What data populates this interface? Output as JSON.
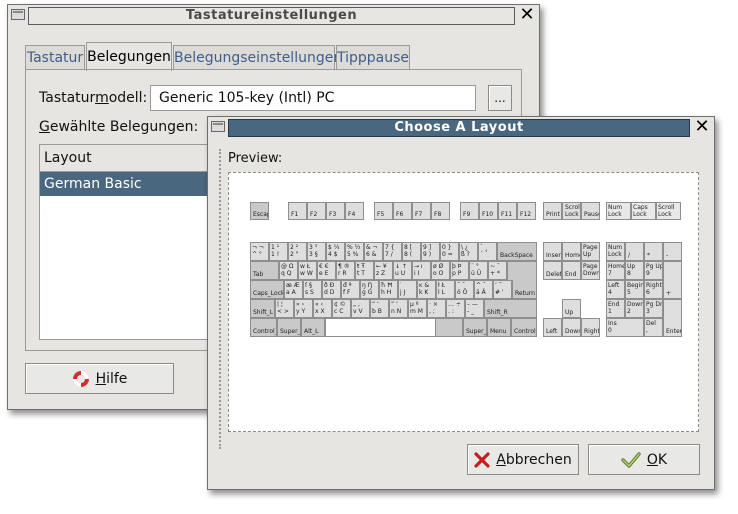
{
  "back_window": {
    "title": "Tastatureinstellungen",
    "tabs": [
      {
        "label": "Tastatur",
        "active": false
      },
      {
        "label": "Belegungen",
        "active": true
      },
      {
        "label": "Belegungseinstellungen",
        "active": false
      },
      {
        "label": "Tipppause",
        "active": false
      }
    ],
    "model_label_pre": "Tastatur",
    "model_label_u": "m",
    "model_label_post": "odell:",
    "model_value": "Generic 105-key (Intl) PC",
    "browse_label": "...",
    "selected_label_pre": "",
    "selected_label_u": "G",
    "selected_label_post": "ewählte Belegungen:",
    "layout_column": "Layout",
    "layouts": [
      "German Basic"
    ],
    "help_u": "H",
    "help_rest": "ilfe"
  },
  "dialog": {
    "title": "Choose A Layout",
    "preview_label": "Preview:",
    "cancel_u": "A",
    "cancel_rest": "bbrechen",
    "ok_u": "O",
    "ok_rest": "K"
  },
  "icons": {
    "help": "lifebuoy-icon",
    "cancel": "red-x-icon",
    "ok": "green-check-icon",
    "close": "close-icon"
  },
  "keys": {
    "esc": "Escape",
    "f1": "F1",
    "f2": "F2",
    "f3": "F3",
    "f4": "F4",
    "f5": "F5",
    "f6": "F6",
    "f7": "F7",
    "f8": "F8",
    "f9": "F9",
    "f10": "F10",
    "f11": "F11",
    "f12": "F12",
    "print": "Print",
    "scroll": "Scroll\nLock",
    "pause": "Pause",
    "numlock": "Num\nLock",
    "capslock_ind": "Caps\nLock",
    "scrolllock_ind": "Scroll\nLock",
    "backspace": "BackSpace",
    "tab": "Tab",
    "return": "Return",
    "capslock": "Caps_Lock",
    "shift_l": "Shift_L",
    "shift_r": "Shift_R",
    "control_l": "Control_L",
    "super_l": "Super_L",
    "alt_l": "Alt_L",
    "super_r": "Super_R",
    "menu": "Menu",
    "control_r": "Control_R",
    "insert": "Insert",
    "home": "Home",
    "pageup": "Page\nUp",
    "delete": "Delete",
    "end": "End",
    "pagedown": "Page\nDown",
    "up": "Up",
    "left": "Left",
    "down": "Down",
    "right": "Right",
    "num_lock_key": "Num\nLock",
    "kp_div": "/",
    "kp_mul": "*",
    "kp_sub": "-",
    "kp_home": "Home\n7",
    "kp_up": "Up\n8",
    "kp_pgup": "Pg Up\n9",
    "kp_add": "+",
    "kp_left": "Left\n4",
    "kp_begin": "Begin\n5",
    "kp_right": "Right\n6",
    "kp_end": "End\n1",
    "kp_down": "Down\n2",
    "kp_pgdn": "Pg Dn\n3",
    "kp_enter": "Enter",
    "kp_ins": "Ins\n0",
    "kp_del": "Del\n,",
    "r1": [
      "¬ ¬\n^ °",
      "1 ¹\n1 !",
      "2 ²\n2 \"",
      "3 ³\n3 §",
      "$ ¼\n4 $",
      "% ½\n5 %",
      "& ¬\n6 &",
      "7 {\n7 /",
      "8 [\n8 (",
      "9 ]\n9 )",
      "0 }\n0 =",
      "\\ ¿\nß ?",
      "` ¸\n´ `"
    ],
    "r2": [
      "@ Ω\nq Q",
      "w Ł\nw W",
      "€ €\ne E",
      "¶ ®\nr R",
      "ŧ Ŧ\nt T",
      "← ¥\nz Z",
      "↓ ↑\nu U",
      "→ ı\ni I",
      "ø Ø\no O",
      "þ Þ\np P",
      "¨ °\nü Ü",
      "~ ¯\n+ *"
    ],
    "r3": [
      "æ Æ\na A",
      "ſ §\ns S",
      "ð Ð\nd D",
      "đ ª\nf F",
      "ŋ Ŋ\ng G",
      "ħ Ħ\nh H",
      "̣ ̇\nj J",
      "ĸ &\nk K",
      "ł Ł\nl L",
      "˝ ˝\nö Ö",
      "^ ˇ\nä Ä",
      "’ ˘\n# '"
    ],
    "r4": [
      "| ¦\n< >",
      "» ›\ny Y",
      "« ‹\nx X",
      "¢ ©\nc C",
      "„ ‚\nv V",
      "“ ‘\nb B",
      "” ’\nn N",
      "µ º\nm M",
      "· ×\n, ;",
      "… ÷\n. :",
      "– —\n- _"
    ],
    "space": "space"
  }
}
